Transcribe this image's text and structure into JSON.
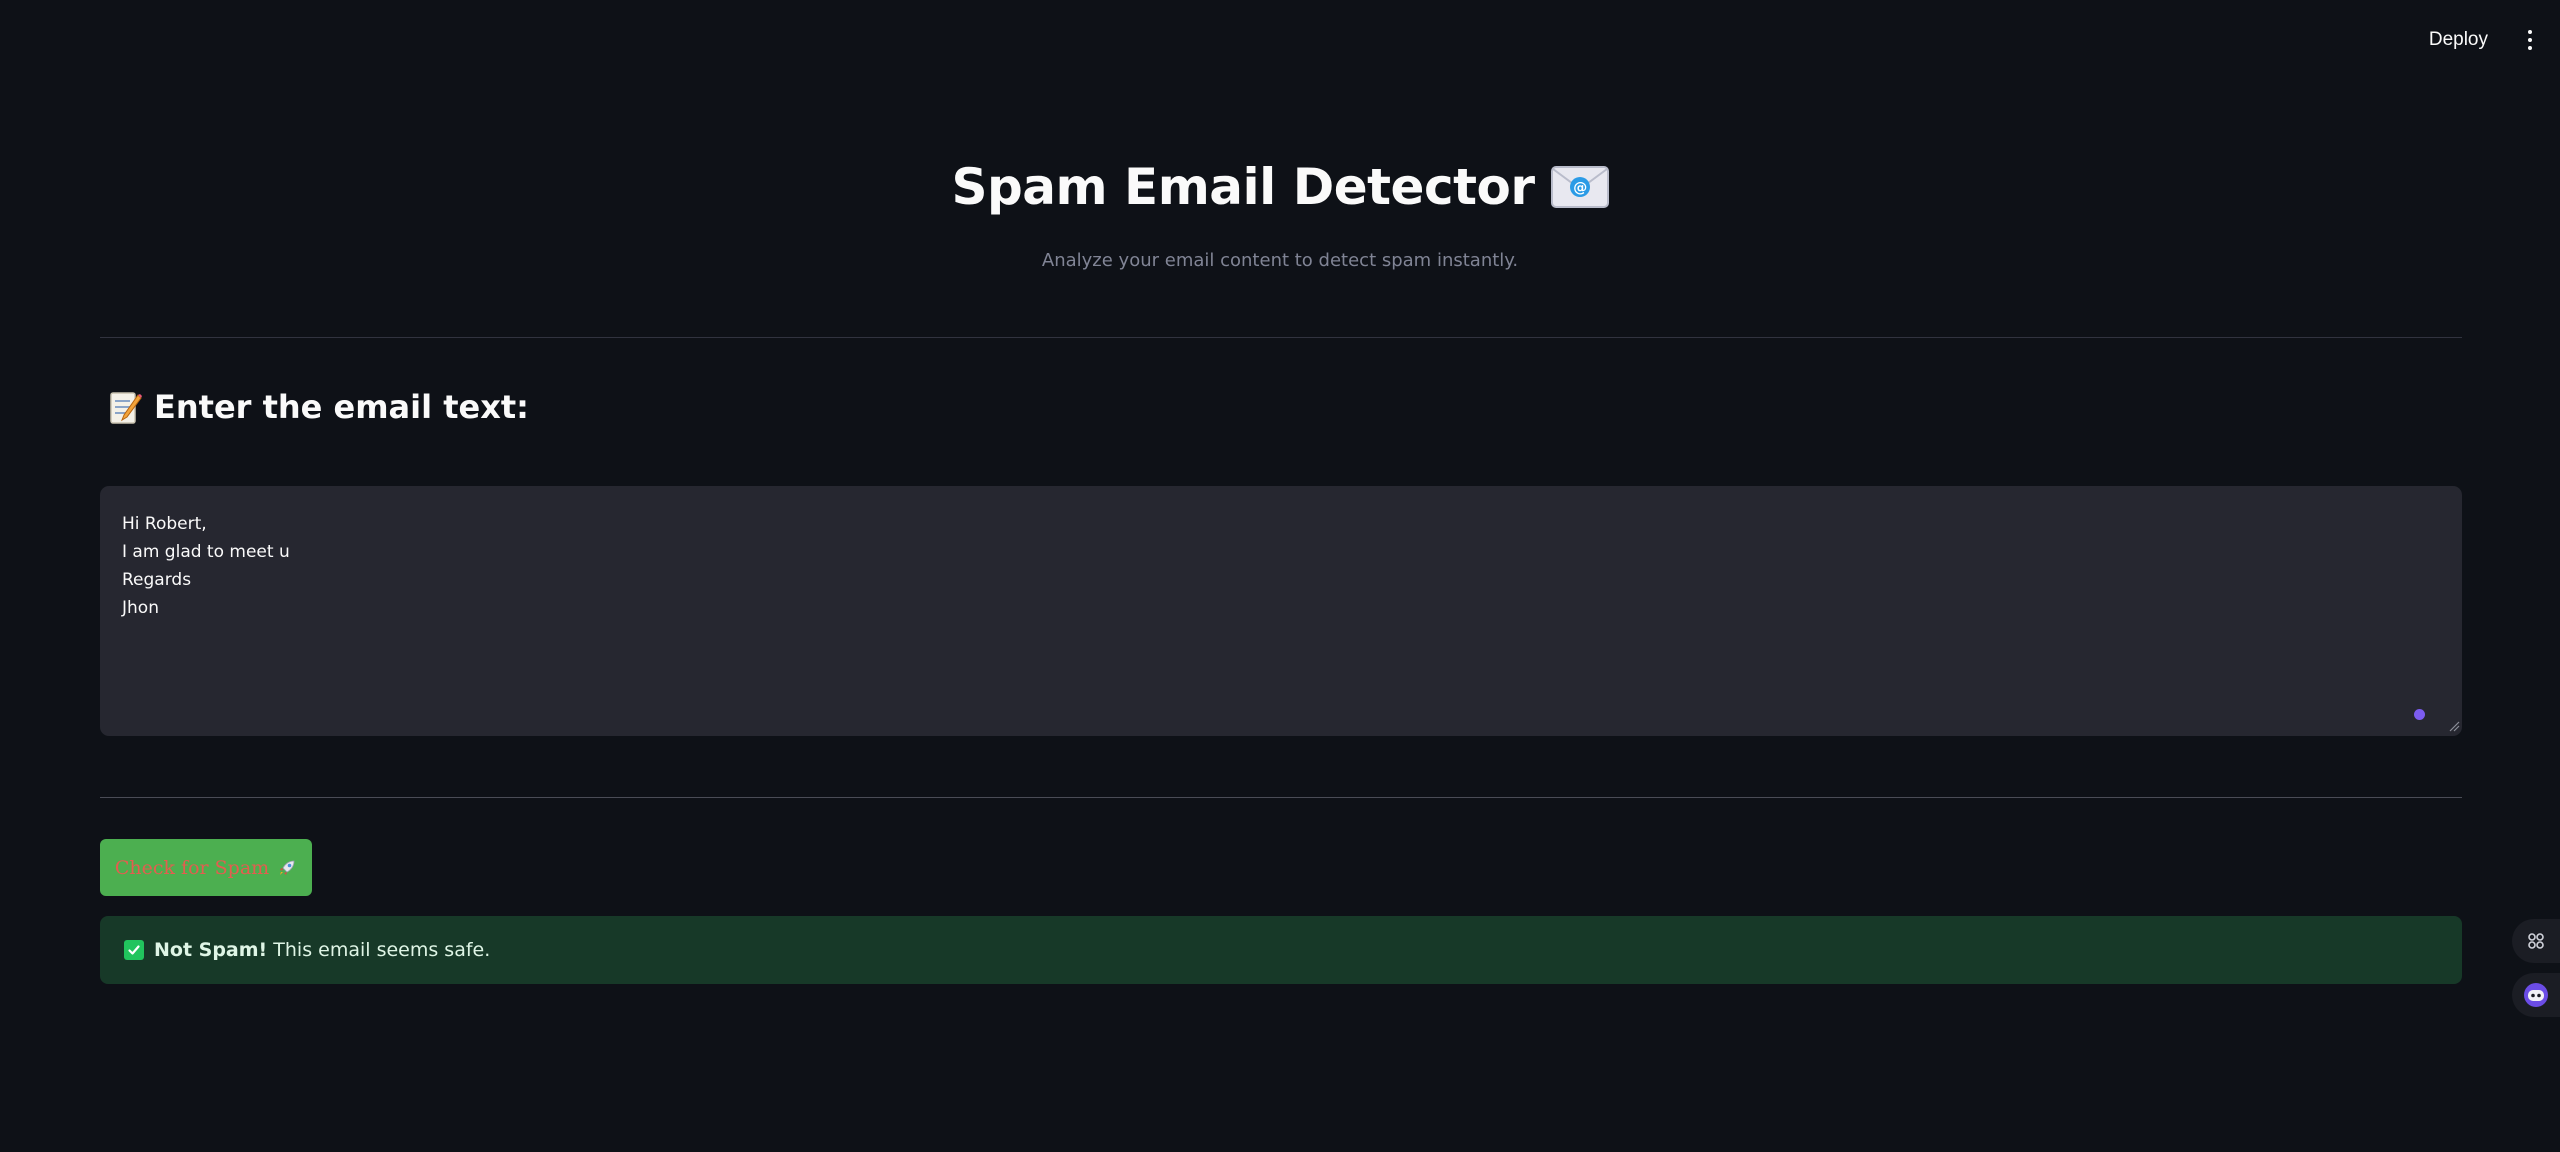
{
  "toolbar": {
    "deploy_label": "Deploy",
    "menu_icon": "kebab-menu-icon"
  },
  "header": {
    "title": "Spam Email Detector",
    "title_icon": "envelope-icon",
    "subtitle": "Analyze your email content to detect spam instantly."
  },
  "input_section": {
    "heading": "Enter the email text:",
    "heading_icon": "memo-icon",
    "textarea_value": "Hi Robert,\nI am glad to meet u\nRegards\nJhon"
  },
  "action": {
    "button_label": "Check for Spam",
    "button_icon": "rocket-icon"
  },
  "result": {
    "icon": "check-icon",
    "strong_text": "Not Spam!",
    "message": "This email seems safe."
  },
  "colors": {
    "background": "#0e1117",
    "textarea_bg": "#262730",
    "button_bg": "#4caf50",
    "button_text": "#e35d4f",
    "success_bg": "#173928",
    "success_icon": "#21c45d",
    "focus_dot": "#7c5cf0"
  },
  "side_widgets": [
    "shortcut-icon",
    "assistant-icon"
  ]
}
